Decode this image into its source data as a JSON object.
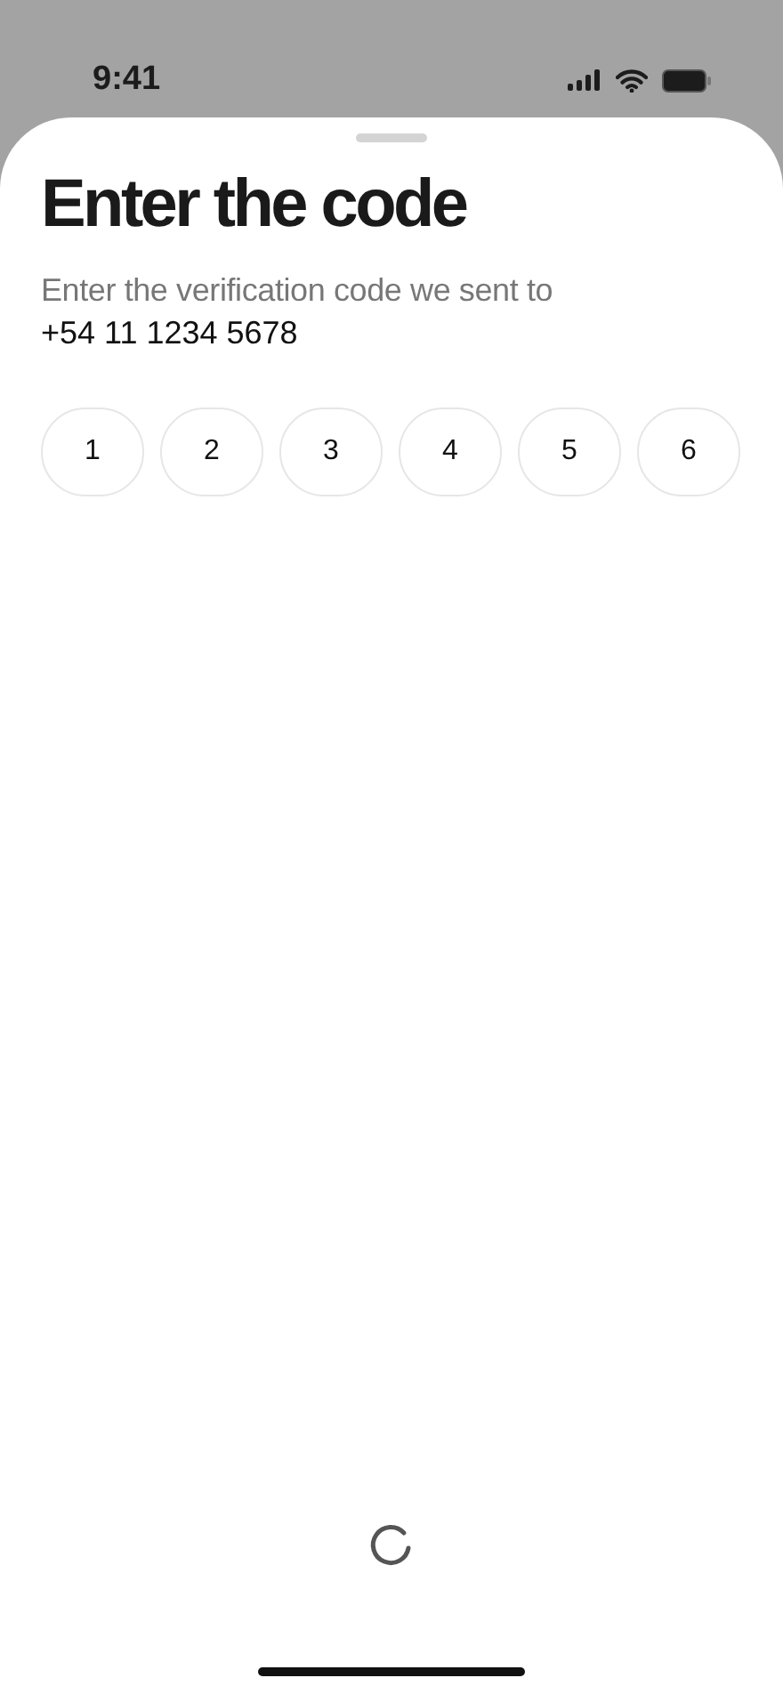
{
  "status_bar": {
    "time": "9:41"
  },
  "sheet": {
    "title": "Enter the code",
    "subtitle": "Enter the verification code we sent to",
    "phone": "+54 11 1234 5678",
    "code_digits": [
      {
        "value": "1"
      },
      {
        "value": "2"
      },
      {
        "value": "3"
      },
      {
        "value": "4"
      },
      {
        "value": "5"
      },
      {
        "value": "6"
      }
    ],
    "loading": true
  }
}
